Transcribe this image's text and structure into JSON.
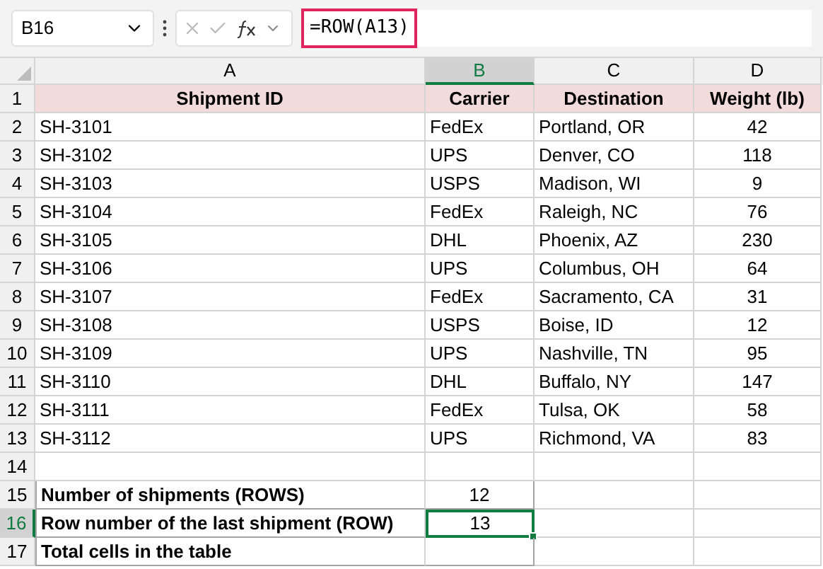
{
  "formula_bar": {
    "name_box": "B16",
    "formula": "=ROW(A13)",
    "formula_highlighted": true
  },
  "columns": [
    {
      "label": "A",
      "selected": false
    },
    {
      "label": "B",
      "selected": true
    },
    {
      "label": "C",
      "selected": false
    },
    {
      "label": "D",
      "selected": false
    }
  ],
  "rows": [
    {
      "number": "1",
      "selected": false,
      "kind": "header",
      "cells": [
        "Shipment ID",
        "Carrier",
        "Destination",
        "Weight (lb)"
      ]
    },
    {
      "number": "2",
      "selected": false,
      "kind": "data",
      "cells": [
        "SH-3101",
        "FedEx",
        "Portland, OR",
        "42"
      ]
    },
    {
      "number": "3",
      "selected": false,
      "kind": "data",
      "cells": [
        "SH-3102",
        "UPS",
        "Denver, CO",
        "118"
      ]
    },
    {
      "number": "4",
      "selected": false,
      "kind": "data",
      "cells": [
        "SH-3103",
        "USPS",
        "Madison, WI",
        "9"
      ]
    },
    {
      "number": "5",
      "selected": false,
      "kind": "data",
      "cells": [
        "SH-3104",
        "FedEx",
        "Raleigh, NC",
        "76"
      ]
    },
    {
      "number": "6",
      "selected": false,
      "kind": "data",
      "cells": [
        "SH-3105",
        "DHL",
        "Phoenix, AZ",
        "230"
      ]
    },
    {
      "number": "7",
      "selected": false,
      "kind": "data",
      "cells": [
        "SH-3106",
        "UPS",
        "Columbus, OH",
        "64"
      ]
    },
    {
      "number": "8",
      "selected": false,
      "kind": "data",
      "cells": [
        "SH-3107",
        "FedEx",
        "Sacramento, CA",
        "31"
      ]
    },
    {
      "number": "9",
      "selected": false,
      "kind": "data",
      "cells": [
        "SH-3108",
        "USPS",
        "Boise, ID",
        "12"
      ]
    },
    {
      "number": "10",
      "selected": false,
      "kind": "data",
      "cells": [
        "SH-3109",
        "UPS",
        "Nashville, TN",
        "95"
      ]
    },
    {
      "number": "11",
      "selected": false,
      "kind": "data",
      "cells": [
        "SH-3110",
        "DHL",
        "Buffalo, NY",
        "147"
      ]
    },
    {
      "number": "12",
      "selected": false,
      "kind": "data",
      "cells": [
        "SH-3111",
        "FedEx",
        "Tulsa, OK",
        "58"
      ]
    },
    {
      "number": "13",
      "selected": false,
      "kind": "data",
      "cells": [
        "SH-3112",
        "UPS",
        "Richmond, VA",
        "83"
      ]
    },
    {
      "number": "14",
      "selected": false,
      "kind": "blank"
    },
    {
      "number": "15",
      "selected": false,
      "kind": "summary",
      "label": "Number of shipments (ROWS)",
      "value": "12"
    },
    {
      "number": "16",
      "selected": true,
      "kind": "summary",
      "label": "Row number of the last shipment (ROW)",
      "value": "13"
    },
    {
      "number": "17",
      "selected": false,
      "kind": "summary",
      "label": "Total cells in the table"
    }
  ]
}
